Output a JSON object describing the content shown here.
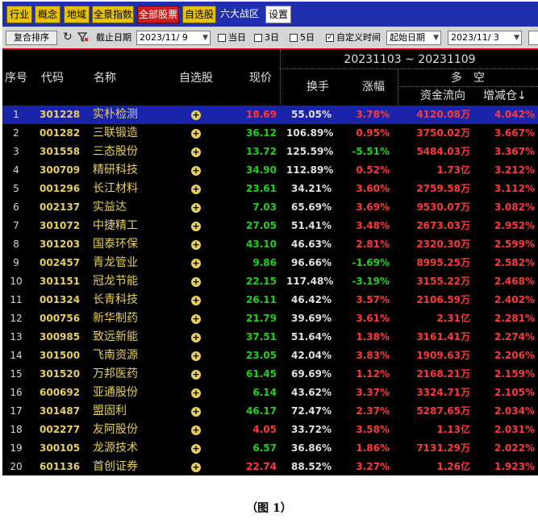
{
  "tabs": [
    {
      "label": "行业",
      "style": "yellow"
    },
    {
      "label": "概念",
      "style": "yellow"
    },
    {
      "label": "地域",
      "style": "yellow"
    },
    {
      "label": "全景指数",
      "style": "yellow"
    },
    {
      "label": "全部股票",
      "style": "red"
    },
    {
      "label": "自选股",
      "style": "yellow"
    },
    {
      "label": "六大战区",
      "style": "plain"
    },
    {
      "label": "设置",
      "style": "white"
    }
  ],
  "toolbar": {
    "sort_button": "复合排序",
    "refresh_icon": "refresh-icon",
    "filter_icon": "filter-clear-icon",
    "end_date_label": "截止日期",
    "end_date_value": "2023/11/ 9",
    "opt_today": "当日",
    "opt_3day": "3日",
    "opt_5day": "5日",
    "opt_custom": "自定义时间",
    "custom_checked": true,
    "start_select": "起始日期",
    "start_date_value": "2023/11/ 3"
  },
  "header": {
    "idx": "序号",
    "code": "代码",
    "name": "名称",
    "watch": "自选股",
    "price": "现价",
    "range": "20231103 ~ 20231109",
    "turnover": "换手",
    "change": "涨幅",
    "duokong": "多　空",
    "flow": "资金流向",
    "increase": "增减仓↓"
  },
  "colors": {
    "up": "#ff3838",
    "down": "#22d022",
    "accent": "#e8d060",
    "selected_row": "#1a24a8"
  },
  "rows": [
    {
      "idx": "1",
      "code": "301228",
      "name": "实朴检测",
      "price": "18.69",
      "price_dir": "up",
      "turnover": "55.05%",
      "change": "3.78%",
      "change_dir": "up",
      "flow": "4120.08万",
      "increase": "4.042%",
      "selected": true
    },
    {
      "idx": "2",
      "code": "001282",
      "name": "三联锻造",
      "price": "36.12",
      "price_dir": "dn",
      "turnover": "106.89%",
      "change": "0.95%",
      "change_dir": "up",
      "flow": "3750.02万",
      "increase": "3.667%"
    },
    {
      "idx": "3",
      "code": "301558",
      "name": "三态股份",
      "price": "13.72",
      "price_dir": "dn",
      "turnover": "125.59%",
      "change": "-5.51%",
      "change_dir": "dn",
      "flow": "5484.03万",
      "increase": "3.367%"
    },
    {
      "idx": "4",
      "code": "300709",
      "name": "精研科技",
      "price": "34.90",
      "price_dir": "dn",
      "turnover": "112.89%",
      "change": "0.52%",
      "change_dir": "up",
      "flow": "1.73亿",
      "increase": "3.212%"
    },
    {
      "idx": "5",
      "code": "001296",
      "name": "长江材料",
      "price": "23.61",
      "price_dir": "dn",
      "turnover": "34.21%",
      "change": "3.60%",
      "change_dir": "up",
      "flow": "2759.58万",
      "increase": "3.112%"
    },
    {
      "idx": "6",
      "code": "002137",
      "name": "实益达",
      "price": "7.03",
      "price_dir": "dn",
      "turnover": "65.69%",
      "change": "3.69%",
      "change_dir": "up",
      "flow": "9530.07万",
      "increase": "3.082%"
    },
    {
      "idx": "7",
      "code": "301072",
      "name": "中捷精工",
      "price": "27.05",
      "price_dir": "dn",
      "turnover": "51.41%",
      "change": "3.48%",
      "change_dir": "up",
      "flow": "2673.03万",
      "increase": "2.952%"
    },
    {
      "idx": "8",
      "code": "301203",
      "name": "国泰环保",
      "price": "43.10",
      "price_dir": "dn",
      "turnover": "46.63%",
      "change": "2.81%",
      "change_dir": "up",
      "flow": "2320.30万",
      "increase": "2.599%"
    },
    {
      "idx": "9",
      "code": "002457",
      "name": "青龙管业",
      "price": "9.86",
      "price_dir": "dn",
      "turnover": "96.66%",
      "change": "-1.69%",
      "change_dir": "dn",
      "flow": "8995.25万",
      "increase": "2.582%"
    },
    {
      "idx": "10",
      "code": "301151",
      "name": "冠龙节能",
      "price": "22.15",
      "price_dir": "dn",
      "turnover": "117.48%",
      "change": "-3.19%",
      "change_dir": "dn",
      "flow": "3155.22万",
      "increase": "2.468%"
    },
    {
      "idx": "11",
      "code": "001324",
      "name": "长青科技",
      "price": "26.11",
      "price_dir": "dn",
      "turnover": "46.42%",
      "change": "3.57%",
      "change_dir": "up",
      "flow": "2106.59万",
      "increase": "2.402%"
    },
    {
      "idx": "12",
      "code": "000756",
      "name": "新华制药",
      "price": "21.79",
      "price_dir": "dn",
      "turnover": "39.69%",
      "change": "3.61%",
      "change_dir": "up",
      "flow": "2.31亿",
      "increase": "2.281%"
    },
    {
      "idx": "13",
      "code": "300985",
      "name": "致远新能",
      "price": "37.51",
      "price_dir": "dn",
      "turnover": "51.64%",
      "change": "1.38%",
      "change_dir": "up",
      "flow": "3161.41万",
      "increase": "2.274%"
    },
    {
      "idx": "14",
      "code": "301500",
      "name": "飞南资源",
      "price": "23.05",
      "price_dir": "dn",
      "turnover": "42.04%",
      "change": "3.83%",
      "change_dir": "up",
      "flow": "1909.63万",
      "increase": "2.206%"
    },
    {
      "idx": "15",
      "code": "301520",
      "name": "万邦医药",
      "price": "61.45",
      "price_dir": "dn",
      "turnover": "69.69%",
      "change": "1.12%",
      "change_dir": "up",
      "flow": "2168.21万",
      "increase": "2.159%"
    },
    {
      "idx": "16",
      "code": "600692",
      "name": "亚通股份",
      "price": "6.14",
      "price_dir": "dn",
      "turnover": "43.62%",
      "change": "3.37%",
      "change_dir": "up",
      "flow": "3324.71万",
      "increase": "2.105%"
    },
    {
      "idx": "17",
      "code": "301487",
      "name": "盟固利",
      "price": "46.17",
      "price_dir": "dn",
      "turnover": "72.47%",
      "change": "2.37%",
      "change_dir": "up",
      "flow": "5287.65万",
      "increase": "2.034%"
    },
    {
      "idx": "18",
      "code": "002277",
      "name": "友阿股份",
      "price": "4.05",
      "price_dir": "up",
      "turnover": "33.72%",
      "change": "3.58%",
      "change_dir": "up",
      "flow": "1.13亿",
      "increase": "2.031%"
    },
    {
      "idx": "19",
      "code": "300105",
      "name": "龙源技术",
      "price": "6.57",
      "price_dir": "dn",
      "turnover": "36.86%",
      "change": "1.86%",
      "change_dir": "up",
      "flow": "7131.29万",
      "increase": "2.022%"
    },
    {
      "idx": "20",
      "code": "601136",
      "name": "首创证券",
      "price": "22.74",
      "price_dir": "up",
      "turnover": "88.52%",
      "change": "3.27%",
      "change_dir": "up",
      "flow": "1.26亿",
      "increase": "1.923%"
    }
  ],
  "caption": "（图 1）"
}
